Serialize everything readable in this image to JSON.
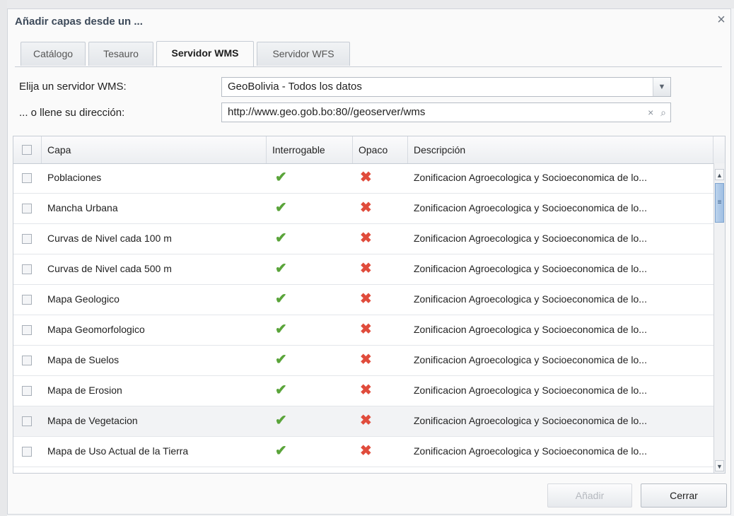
{
  "dialog": {
    "title": "Añadir capas desde un ..."
  },
  "tabs": [
    {
      "label": "Catálogo"
    },
    {
      "label": "Tesauro"
    },
    {
      "label": "Servidor WMS"
    },
    {
      "label": "Servidor WFS"
    }
  ],
  "active_tab": "Servidor WMS",
  "form": {
    "server_label": "Elija un servidor WMS:",
    "server_value": "GeoBolivia - Todos los datos",
    "url_label": "... o llene su dirección:",
    "url_value": "http://www.geo.gob.bo:80//geoserver/wms"
  },
  "grid": {
    "headers": {
      "capa": "Capa",
      "interrogable": "Interrogable",
      "opaco": "Opaco",
      "descripcion": "Descripción"
    },
    "rows": [
      {
        "capa": "Poblaciones",
        "desc": "Zonificacion Agroecologica y Socioeconomica de lo..."
      },
      {
        "capa": "Mancha Urbana",
        "desc": "Zonificacion Agroecologica y Socioeconomica de lo..."
      },
      {
        "capa": "Curvas de Nivel cada 100 m",
        "desc": "Zonificacion Agroecologica y Socioeconomica de lo..."
      },
      {
        "capa": "Curvas de Nivel cada 500 m",
        "desc": "Zonificacion Agroecologica y Socioeconomica de lo..."
      },
      {
        "capa": "Mapa Geologico",
        "desc": "Zonificacion Agroecologica y Socioeconomica de lo..."
      },
      {
        "capa": "Mapa Geomorfologico",
        "desc": "Zonificacion Agroecologica y Socioeconomica de lo..."
      },
      {
        "capa": "Mapa de Suelos",
        "desc": "Zonificacion Agroecologica y Socioeconomica de lo..."
      },
      {
        "capa": "Mapa de Erosion",
        "desc": "Zonificacion Agroecologica y Socioeconomica de lo..."
      },
      {
        "capa": "Mapa de Vegetacion",
        "desc": "Zonificacion Agroecologica y Socioeconomica de lo..."
      },
      {
        "capa": "Mapa de Uso Actual de la Tierra",
        "desc": "Zonificacion Agroecologica y Socioeconomica de lo..."
      }
    ],
    "interrogable_icon": "check-icon",
    "opaco_icon": "x-icon"
  },
  "buttons": {
    "add": "Añadir",
    "close": "Cerrar"
  },
  "colors": {
    "check": "#5aa43a",
    "cross": "#e04c3c",
    "thumb": "#9ebee3"
  }
}
